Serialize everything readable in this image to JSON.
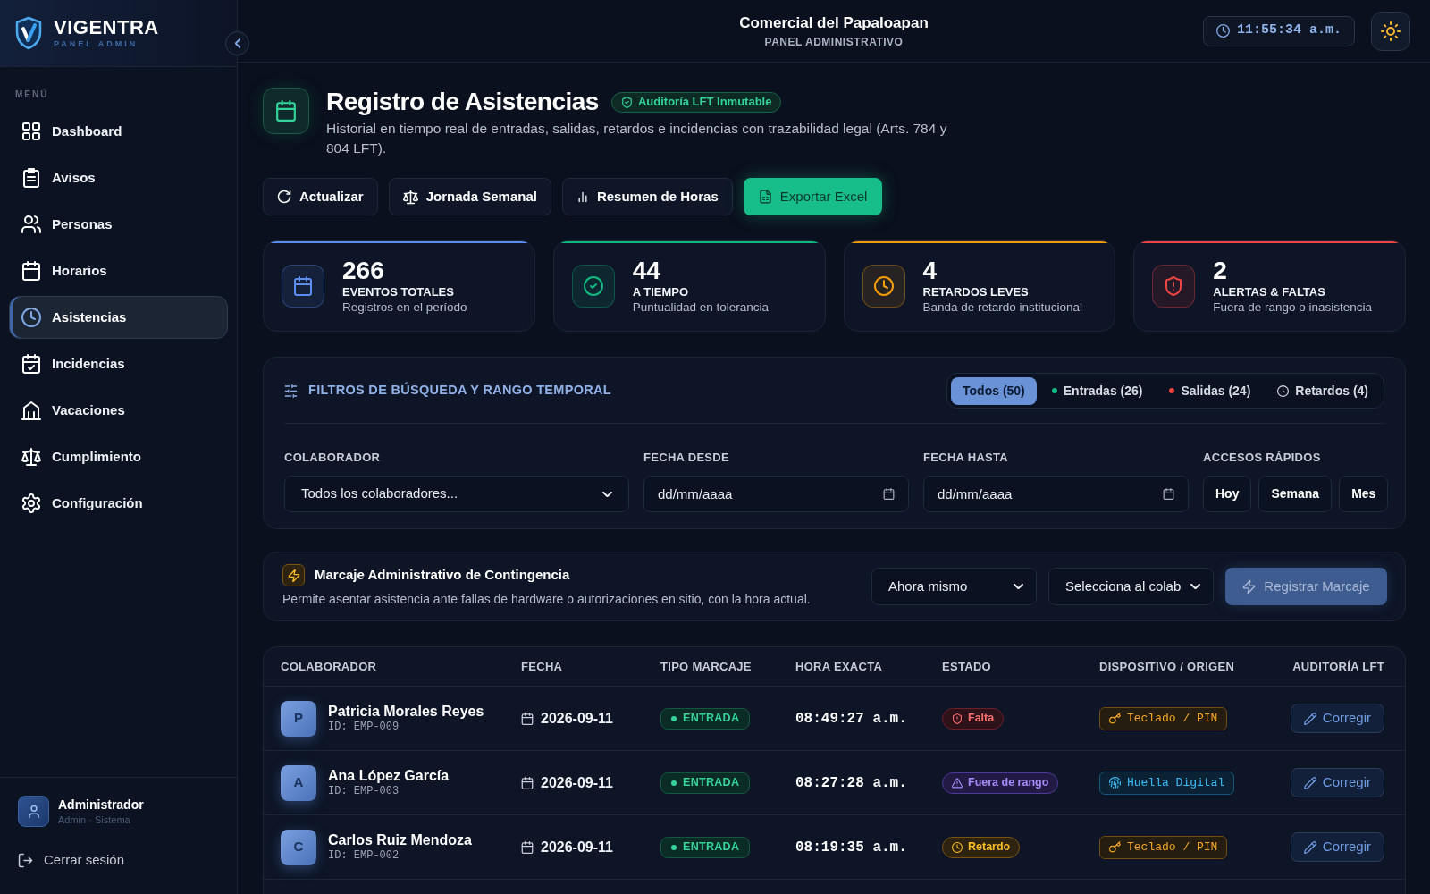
{
  "sidebar": {
    "brand": {
      "name": "VIGENTRA",
      "subtitle": "PANEL ADMIN"
    },
    "section_label": "MENÚ",
    "items": [
      {
        "label": "Dashboard",
        "kind": "grid",
        "selected": false
      },
      {
        "label": "Avisos",
        "kind": "clipboard",
        "selected": false
      },
      {
        "label": "Personas",
        "kind": "users",
        "selected": false
      },
      {
        "label": "Horarios",
        "kind": "calendar",
        "selected": false
      },
      {
        "label": "Asistencias",
        "kind": "clock",
        "selected": true
      },
      {
        "label": "Incidencias",
        "kind": "calendar_check",
        "selected": false
      },
      {
        "label": "Vacaciones",
        "kind": "building",
        "selected": false
      },
      {
        "label": "Cumplimiento",
        "kind": "scale",
        "selected": false
      },
      {
        "label": "Configuración",
        "kind": "gear",
        "selected": false
      }
    ],
    "user": {
      "name": "Administrador",
      "role": "Admin · Sistema"
    },
    "logout": "Cerrar sesión"
  },
  "top_bar": {
    "title": "Comercial del Papaloapan",
    "subtitle": "PANEL ADMINISTRATIVO",
    "clock": "11:55:34 a.m."
  },
  "page_header": {
    "title": "Registro de Asistencias",
    "badge": "Auditoría LFT Inmutable",
    "description": "Historial en tiempo real de entradas, salidas, retardos e incidencias con trazabilidad legal (Arts. 784 y 804 LFT).",
    "actions": [
      {
        "label": "Actualizar",
        "kind": "refresh"
      },
      {
        "label": "Jornada Semanal",
        "kind": "scale"
      },
      {
        "label": "Resumen de Horas",
        "kind": "bars"
      },
      {
        "label": "Exportar Excel",
        "kind": "export"
      }
    ]
  },
  "stats": [
    {
      "value": "266",
      "label": "EVENTOS TOTALES",
      "caption": "Registros en el período",
      "kind": "calendar",
      "color": "#5b8def"
    },
    {
      "value": "44",
      "label": "A TIEMPO",
      "caption": "Puntualidad en tolerancia",
      "kind": "check",
      "color": "#10b981"
    },
    {
      "value": "4",
      "label": "RETARDOS LEVES",
      "caption": "Banda de retardo institucional",
      "kind": "clock",
      "color": "#f59e0b"
    },
    {
      "value": "2",
      "label": "ALERTAS & FALTAS",
      "caption": "Fuera de rango o inasistencia",
      "kind": "shield",
      "color": "#ef4444"
    }
  ],
  "filters": {
    "title": "FILTROS DE BÚSQUEDA Y RANGO TEMPORAL",
    "tabs": [
      {
        "label": "Todos (50)",
        "kind": "plain",
        "selected": true
      },
      {
        "label": "Entradas (26)",
        "kind": "dot",
        "color": "#10b981",
        "selected": false
      },
      {
        "label": "Salidas (24)",
        "kind": "dot",
        "color": "#ef4444",
        "selected": false
      },
      {
        "label": "Retardos (4)",
        "kind": "clock",
        "selected": false
      }
    ],
    "collaborator": {
      "label": "COLABORADOR",
      "value": "Todos los colaboradores..."
    },
    "date_from": {
      "label": "FECHA DESDE",
      "placeholder": "dd/mm/aaaa"
    },
    "date_to": {
      "label": "FECHA HASTA",
      "placeholder": "dd/mm/aaaa"
    },
    "quick_access": {
      "label": "ACCESOS RÁPIDOS",
      "buttons": [
        "Hoy",
        "Semana",
        "Mes"
      ]
    }
  },
  "manual_punch": {
    "title": "Marcaje Administrativo de Contingencia",
    "description": "Permite asentar asistencia ante fallas de hardware o autorizaciones en sitio, con la hora actual.",
    "time_select": "Ahora mismo",
    "collaborator_select": "Selecciona al colab",
    "submit": {
      "label": "Registrar Marcaje",
      "disabled": true
    }
  },
  "table": {
    "columns": [
      "COLABORADOR",
      "FECHA",
      "TIPO MARCAJE",
      "HORA EXACTA",
      "ESTADO",
      "DISPOSITIVO / ORIGEN",
      "AUDITORÍA LFT"
    ],
    "rows": [
      {
        "initial": "P",
        "name": "Patricia Morales Reyes",
        "id": "ID: EMP-009",
        "date": "2026-09-11",
        "type": {
          "label": "ENTRADA",
          "kind": "entrada"
        },
        "time": "08:49:27 a.m.",
        "status": {
          "label": "Falta",
          "kind": "falta"
        },
        "device": {
          "label": "Teclado / PIN",
          "kind": "keypad"
        },
        "action": "Corregir"
      },
      {
        "initial": "A",
        "name": "Ana López García",
        "id": "ID: EMP-003",
        "date": "2026-09-11",
        "type": {
          "label": "ENTRADA",
          "kind": "entrada"
        },
        "time": "08:27:28 a.m.",
        "status": {
          "label": "Fuera de rango",
          "kind": "out_of_range"
        },
        "device": {
          "label": "Huella Digital",
          "kind": "fingerprint"
        },
        "action": "Corregir"
      },
      {
        "initial": "C",
        "name": "Carlos Ruiz Mendoza",
        "id": "ID: EMP-002",
        "date": "2026-09-11",
        "type": {
          "label": "ENTRADA",
          "kind": "entrada"
        },
        "time": "08:19:35 a.m.",
        "status": {
          "label": "Retardo",
          "kind": "retardo"
        },
        "device": {
          "label": "Teclado / PIN",
          "kind": "keypad"
        },
        "action": "Corregir"
      }
    ]
  }
}
